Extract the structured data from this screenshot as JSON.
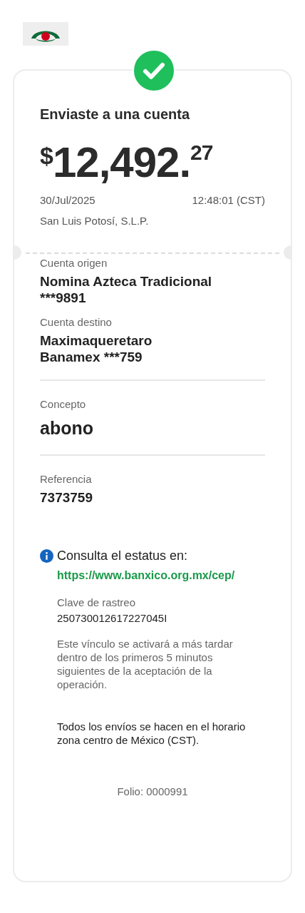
{
  "header": {
    "title": "Enviaste a una cuenta",
    "amount": {
      "currency": "$",
      "whole": "12,492.",
      "cents": "27"
    },
    "date": "30/Jul/2025",
    "time": "12:48:01 (CST)",
    "location": "San Luis Potosí, S.L.P."
  },
  "sections": [
    {
      "fields": [
        {
          "label": "Cuenta origen",
          "value": "Nomina Azteca Tradicional\n***9891",
          "kind": "normal"
        },
        {
          "label": "Cuenta destino",
          "value": "Maximaqueretaro\nBanamex ***759",
          "kind": "normal"
        }
      ]
    },
    {
      "fields": [
        {
          "label": "Concepto",
          "value": "abono",
          "kind": "large"
        }
      ]
    },
    {
      "fields": [
        {
          "label": "Referencia",
          "value": "7373759",
          "kind": "normal"
        }
      ]
    }
  ],
  "status": {
    "title": "Consulta el estatus en:",
    "link": "https://www.banxico.org.mx/cep/",
    "tracking_label": "Clave de rastreo",
    "tracking_value": "250730012617227045I",
    "note": "Este vínculo se activará a más tardar dentro de los primeros 5 minutos siguientes de la aceptación de la operación.",
    "schedule": "Todos los envíos se hacen en el horario zona centro de México (CST)."
  },
  "folio": "Folio: 0000991"
}
